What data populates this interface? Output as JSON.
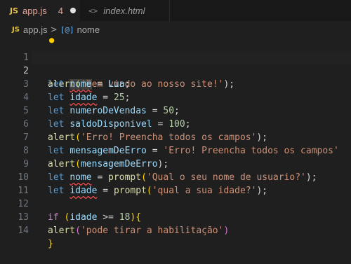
{
  "tabs": [
    {
      "badge": "JS",
      "title": "app.js",
      "problem_count": "4",
      "dirty": true
    },
    {
      "icon": "<>",
      "title": "index.html"
    }
  ],
  "breadcrumb": {
    "badge": "JS",
    "file": "app.js",
    "separator": ">",
    "symbol_icon": "[@]",
    "symbol": "nome"
  },
  "editor": {
    "line_numbers": [
      "1",
      "2",
      "3",
      "4",
      "5",
      "6",
      "7",
      "8",
      "9",
      "10",
      "11",
      "12",
      "13",
      "14"
    ],
    "current_line": "2"
  },
  "code": {
    "l1": [
      "alert",
      "(",
      "'Bem vindo ao nosso site!'",
      ");"
    ],
    "l2": [
      "let",
      "nome",
      " = ",
      "Lua",
      ";"
    ],
    "l3": [
      "let",
      "idade",
      " = ",
      "25",
      ";"
    ],
    "l4": [
      "let",
      "numeroDeVendas",
      " = ",
      "50",
      ";"
    ],
    "l5": [
      "let",
      "saldoDisponivel",
      " = ",
      "100",
      ";"
    ],
    "l6": [
      "alert",
      "(",
      "'Erro! Preencha todos os campos'",
      ");"
    ],
    "l7": [
      "let",
      "mensagemDeErro",
      " = ",
      "'Erro! Preencha todos os campos'"
    ],
    "l8": [
      "alert",
      "(",
      "mensagemDeErro",
      ");"
    ],
    "l9": [
      "let",
      "nome",
      " = ",
      "prompt",
      "(",
      "'Qual o seu nome de usuario?'",
      ");"
    ],
    "l10": [
      "let",
      "idade",
      " = ",
      "prompt",
      "(",
      "'qual a sua idade?'",
      ");"
    ],
    "l12": [
      "if",
      " (",
      "idade",
      " >= ",
      "18",
      ")",
      "{"
    ],
    "l13": [
      "alert",
      "(",
      "'pode tirar a habilitação'",
      ")"
    ],
    "l14": [
      "}"
    ]
  }
}
